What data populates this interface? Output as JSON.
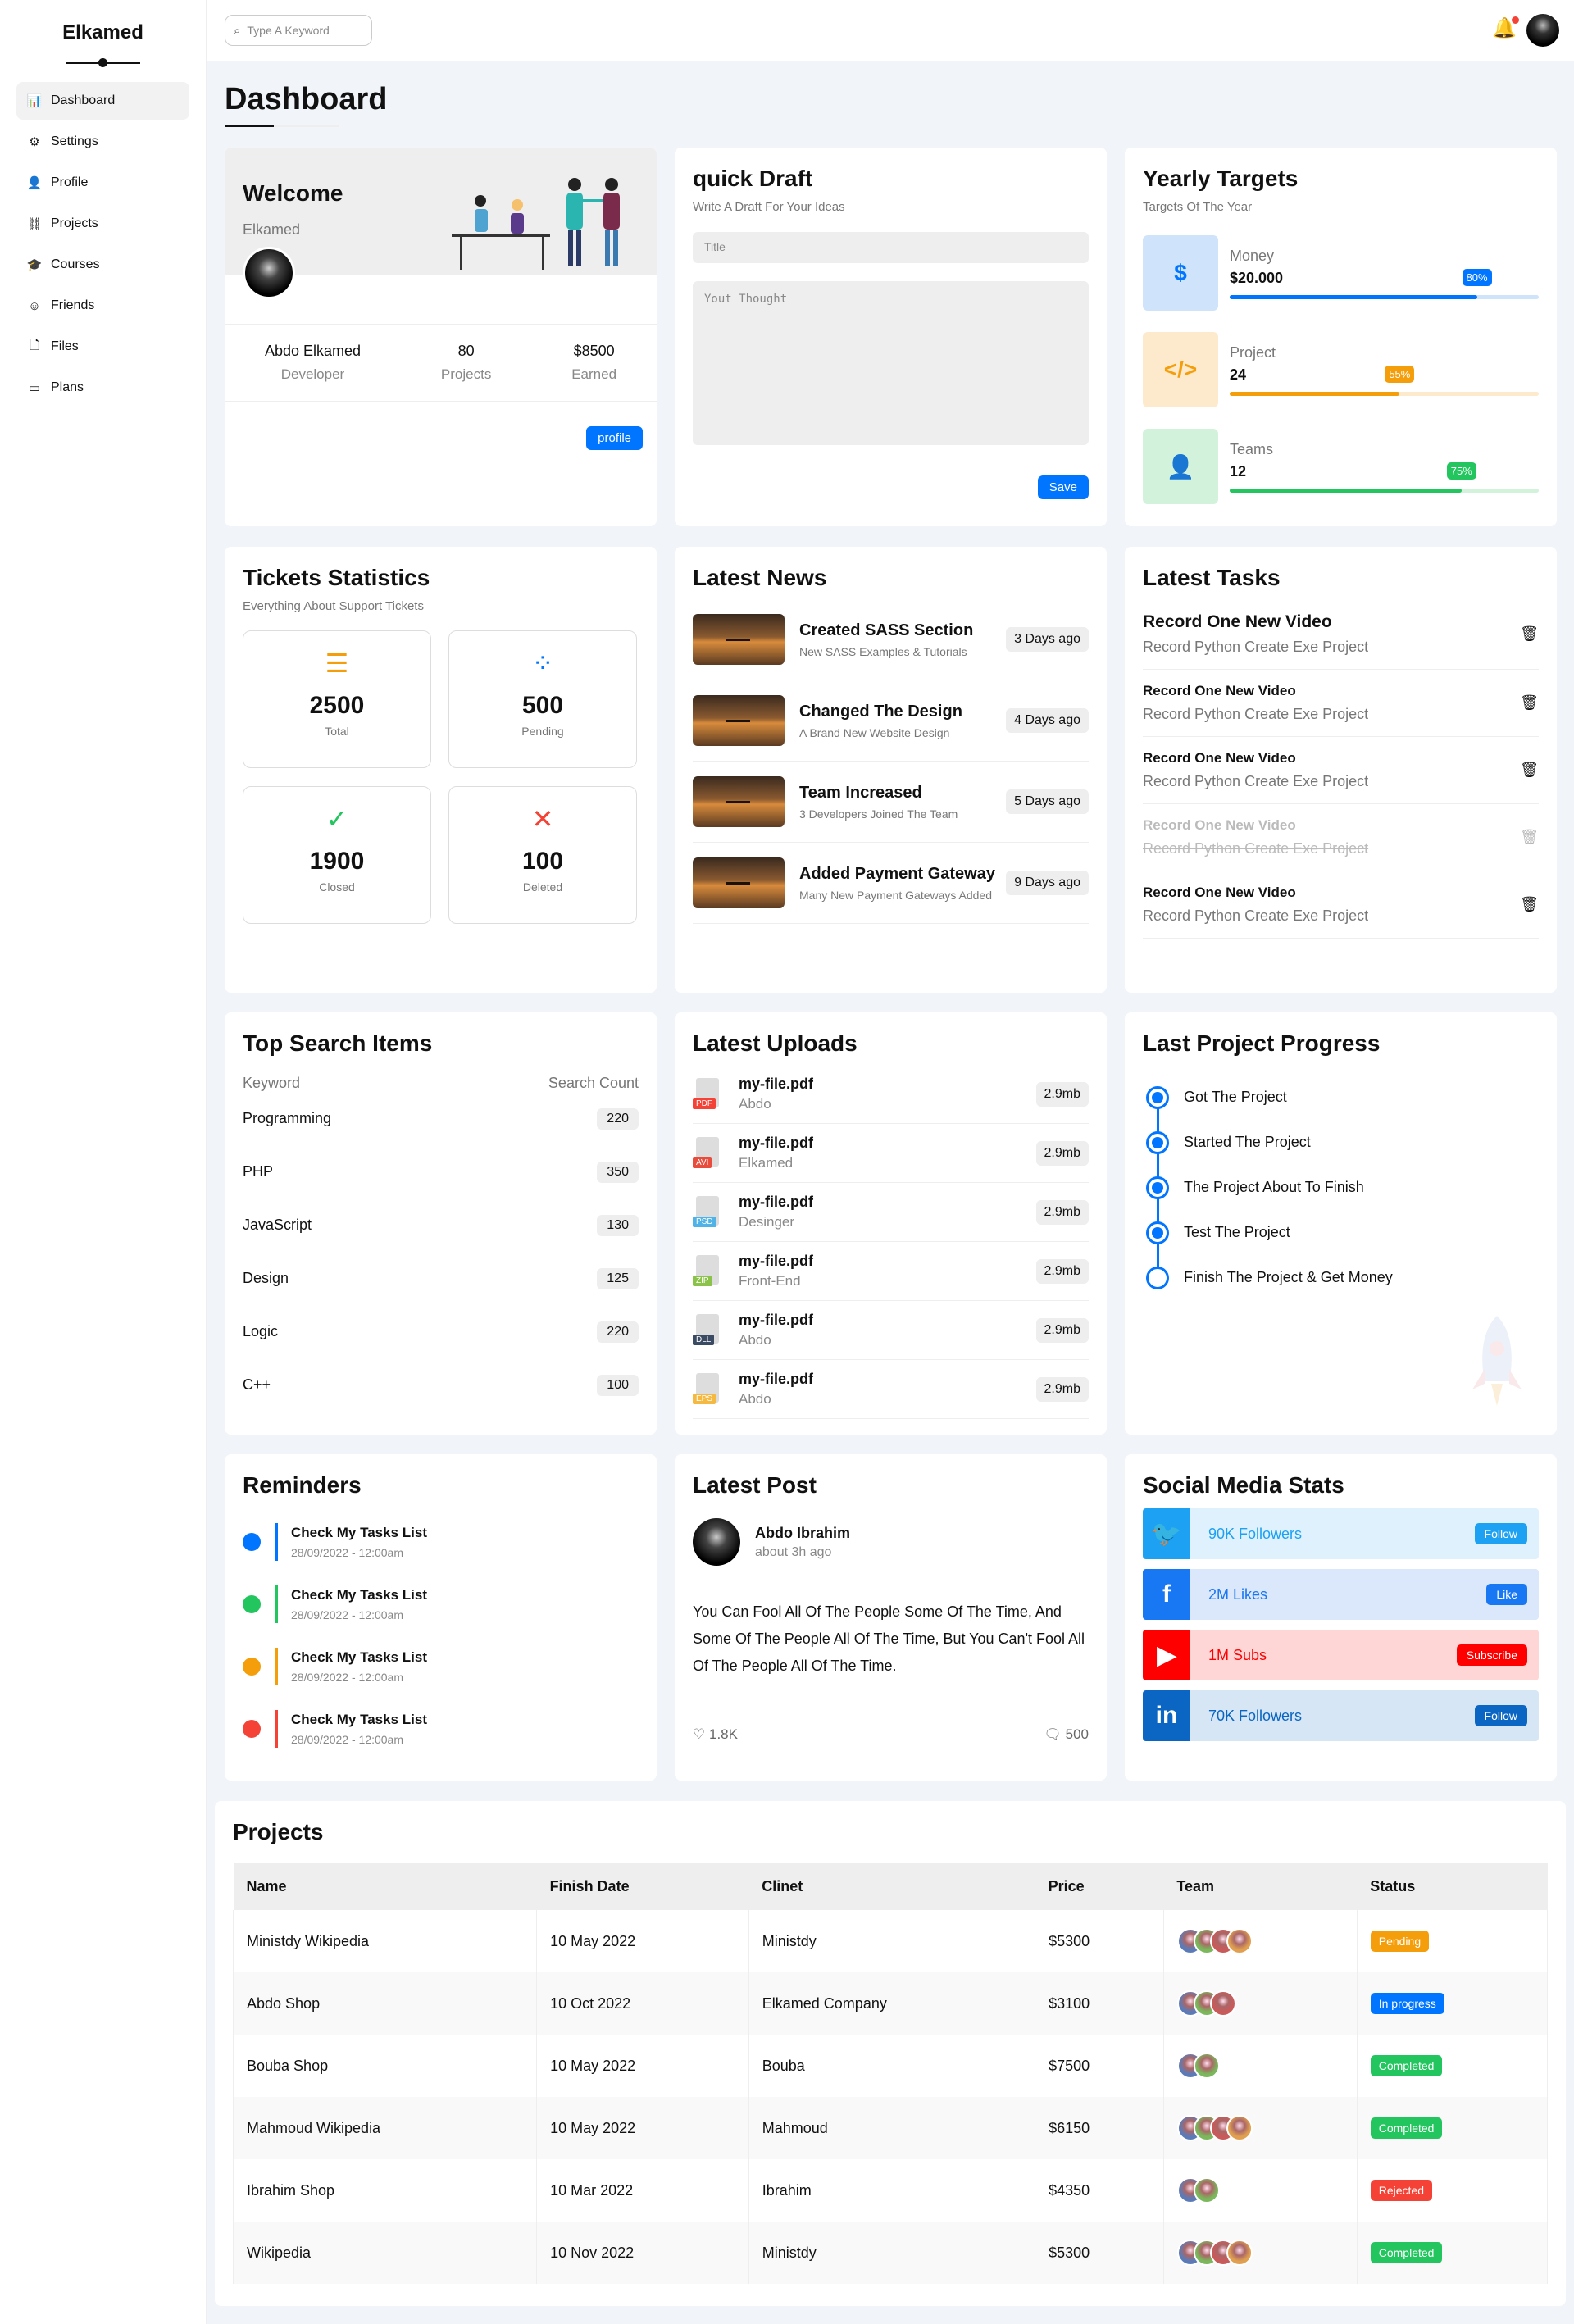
{
  "brand": "Elkamed",
  "sidebar": {
    "items": [
      {
        "label": "Dashboard",
        "icon": "chart-icon"
      },
      {
        "label": "Settings",
        "icon": "gear-icon"
      },
      {
        "label": "Profile",
        "icon": "user-icon"
      },
      {
        "label": "Projects",
        "icon": "diagram-icon"
      },
      {
        "label": "Courses",
        "icon": "graduation-cap-icon"
      },
      {
        "label": "Friends",
        "icon": "friends-icon"
      },
      {
        "label": "Files",
        "icon": "file-icon"
      },
      {
        "label": "Plans",
        "icon": "card-icon"
      }
    ]
  },
  "topbar": {
    "search_placeholder": "Type A Keyword"
  },
  "page_title": "Dashboard",
  "welcome": {
    "title": "Welcome",
    "name": "Elkamed",
    "stats": [
      {
        "value": "Abdo Elkamed",
        "label": "Developer"
      },
      {
        "value": "80",
        "label": "Projects"
      },
      {
        "value": "$8500",
        "label": "Earned"
      }
    ],
    "button": "profile"
  },
  "draft": {
    "title": "quick Draft",
    "subtitle": "Write A Draft For Your Ideas",
    "title_placeholder": "Title",
    "thought_placeholder": "Yout Thought",
    "save": "Save"
  },
  "targets": {
    "title": "Yearly Targets",
    "subtitle": "Targets Of The Year",
    "items": [
      {
        "label": "Money",
        "value": "$20.000",
        "percent": 80,
        "percent_label": "80%",
        "color": "#0075ff",
        "bg": "#cfe3fb",
        "icon": "$"
      },
      {
        "label": "Project",
        "value": "24",
        "percent": 55,
        "percent_label": "55%",
        "color": "#f59e0b",
        "bg": "#fdeacd",
        "icon": "</>"
      },
      {
        "label": "Teams",
        "value": "12",
        "percent": 75,
        "percent_label": "75%",
        "color": "#22c55e",
        "bg": "#d3f2dc",
        "icon": "👤"
      }
    ]
  },
  "tickets": {
    "title": "Tickets Statistics",
    "subtitle": "Everything About Support Tickets",
    "items": [
      {
        "value": "2500",
        "label": "Total",
        "icon": "list-icon",
        "glyph": "☰",
        "color": "#f59e0b"
      },
      {
        "value": "500",
        "label": "Pending",
        "icon": "spinner-icon",
        "glyph": "⁘",
        "color": "#0075ff"
      },
      {
        "value": "1900",
        "label": "Closed",
        "icon": "check-circle-icon",
        "glyph": "✓",
        "color": "#22c55e"
      },
      {
        "value": "100",
        "label": "Deleted",
        "icon": "close-square-icon",
        "glyph": "✕",
        "color": "#f44336"
      }
    ]
  },
  "news": {
    "title": "Latest News",
    "items": [
      {
        "title": "Created SASS Section",
        "desc": "New SASS Examples & Tutorials",
        "time": "3 Days ago"
      },
      {
        "title": "Changed The Design",
        "desc": "A Brand New Website Design",
        "time": "4 Days ago"
      },
      {
        "title": "Team Increased",
        "desc": "3 Developers Joined The Team",
        "time": "5 Days ago"
      },
      {
        "title": "Added Payment Gateway",
        "desc": "Many New Payment Gateways Added",
        "time": "9 Days ago"
      }
    ]
  },
  "tasks": {
    "title": "Latest Tasks",
    "items": [
      {
        "title": "Record One New Video",
        "desc": "Record Python Create Exe Project",
        "done": false
      },
      {
        "title": "Record One New Video",
        "desc": "Record Python Create Exe Project",
        "done": false
      },
      {
        "title": "Record One New Video",
        "desc": "Record Python Create Exe Project",
        "done": false
      },
      {
        "title": "Record One New Video",
        "desc": "Record Python Create Exe Project",
        "done": true
      },
      {
        "title": "Record One New Video",
        "desc": "Record Python Create Exe Project",
        "done": false
      }
    ]
  },
  "search_items": {
    "title": "Top Search Items",
    "col_keyword": "Keyword",
    "col_count": "Search Count",
    "rows": [
      {
        "keyword": "Programming",
        "count": "220"
      },
      {
        "keyword": "PHP",
        "count": "350"
      },
      {
        "keyword": "JavaScript",
        "count": "130"
      },
      {
        "keyword": "Design",
        "count": "125"
      },
      {
        "keyword": "Logic",
        "count": "220"
      },
      {
        "keyword": "C++",
        "count": "100"
      }
    ]
  },
  "uploads": {
    "title": "Latest Uploads",
    "items": [
      {
        "name": "my-file.pdf",
        "author": "Abdo",
        "size": "2.9mb",
        "type": "PDF",
        "color": "#f44336"
      },
      {
        "name": "my-file.pdf",
        "author": "Elkamed",
        "size": "2.9mb",
        "type": "AVI",
        "color": "#e74c3c"
      },
      {
        "name": "my-file.pdf",
        "author": "Desinger",
        "size": "2.9mb",
        "type": "PSD",
        "color": "#4fb3e8"
      },
      {
        "name": "my-file.pdf",
        "author": "Front-End",
        "size": "2.9mb",
        "type": "ZIP",
        "color": "#8bc34a"
      },
      {
        "name": "my-file.pdf",
        "author": "Abdo",
        "size": "2.9mb",
        "type": "DLL",
        "color": "#3c4b64"
      },
      {
        "name": "my-file.pdf",
        "author": "Abdo",
        "size": "2.9mb",
        "type": "EPS",
        "color": "#f5b942"
      }
    ]
  },
  "progress": {
    "title": "Last Project Progress",
    "items": [
      {
        "label": "Got The Project",
        "done": true
      },
      {
        "label": "Started The Project",
        "done": true
      },
      {
        "label": "The Project About To Finish",
        "done": true
      },
      {
        "label": "Test The Project",
        "done": true
      },
      {
        "label": "Finish The Project & Get Money",
        "done": false
      }
    ]
  },
  "reminders": {
    "title": "Reminders",
    "items": [
      {
        "title": "Check My Tasks List",
        "date": "28/09/2022 - 12:00am",
        "color": "#0075ff"
      },
      {
        "title": "Check My Tasks List",
        "date": "28/09/2022 - 12:00am",
        "color": "#22c55e"
      },
      {
        "title": "Check My Tasks List",
        "date": "28/09/2022 - 12:00am",
        "color": "#f59e0b"
      },
      {
        "title": "Check My Tasks List",
        "date": "28/09/2022 - 12:00am",
        "color": "#f44336"
      }
    ]
  },
  "post": {
    "title": "Latest Post",
    "author": "Abdo Ibrahim",
    "time": "about 3h ago",
    "body": "You Can Fool All Of The People Some Of The Time, And Some Of The People All Of The Time, But You Can't Fool All Of The People All Of The Time.",
    "likes": "1.8K",
    "comments": "500"
  },
  "social": {
    "title": "Social Media Stats",
    "items": [
      {
        "label": "90K Followers",
        "button": "Follow",
        "icon": "twitter-icon",
        "glyph": "🐦",
        "color": "#1da1f2",
        "bg": "#dff1fd"
      },
      {
        "label": "2M Likes",
        "button": "Like",
        "icon": "facebook-icon",
        "glyph": "f",
        "color": "#1877f2",
        "bg": "#dbe7fb"
      },
      {
        "label": "1M Subs",
        "button": "Subscribe",
        "icon": "youtube-icon",
        "glyph": "▶",
        "color": "#ff0000",
        "bg": "#ffd6d6"
      },
      {
        "label": "70K Followers",
        "button": "Follow",
        "icon": "linkedin-icon",
        "glyph": "in",
        "color": "#0a66c2",
        "bg": "#d6e6f5"
      }
    ]
  },
  "projects": {
    "title": "Projects",
    "headers": [
      "Name",
      "Finish Date",
      "Clinet",
      "Price",
      "Team",
      "Status"
    ],
    "rows": [
      {
        "name": "Ministdy Wikipedia",
        "date": "10 May 2022",
        "client": "Ministdy",
        "price": "$5300",
        "team": 4,
        "status": "Pending",
        "status_color": "#f59e0b"
      },
      {
        "name": "Abdo Shop",
        "date": "10 Oct 2022",
        "client": "Elkamed Company",
        "price": "$3100",
        "team": 3,
        "status": "In progress",
        "status_color": "#0075ff"
      },
      {
        "name": "Bouba Shop",
        "date": "10 May 2022",
        "client": "Bouba",
        "price": "$7500",
        "team": 2,
        "status": "Completed",
        "status_color": "#22c55e"
      },
      {
        "name": "Mahmoud Wikipedia",
        "date": "10 May 2022",
        "client": "Mahmoud",
        "price": "$6150",
        "team": 4,
        "status": "Completed",
        "status_color": "#22c55e"
      },
      {
        "name": "Ibrahim Shop",
        "date": "10 Mar 2022",
        "client": "Ibrahim",
        "price": "$4350",
        "team": 2,
        "status": "Rejected",
        "status_color": "#f44336"
      },
      {
        "name": "Wikipedia",
        "date": "10 Nov 2022",
        "client": "Ministdy",
        "price": "$5300",
        "team": 4,
        "status": "Completed",
        "status_color": "#22c55e"
      }
    ]
  }
}
